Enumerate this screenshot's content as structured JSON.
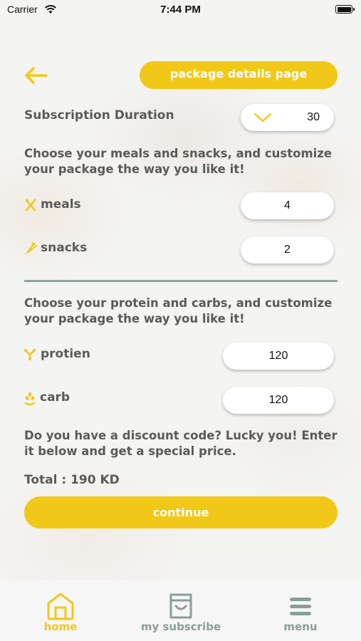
{
  "status_bar": {
    "carrier": "Carrier",
    "time": "7:44 PM"
  },
  "header": {
    "title": "package details page",
    "back_icon": "arrow-left-icon"
  },
  "subscription": {
    "label": "Subscription Duration",
    "value": "30",
    "dropdown_icon": "chevron-down-icon"
  },
  "meals_intro": "Choose your meals and snacks, and customize your package the way you like it!",
  "meals": {
    "label": "meals",
    "value": "4",
    "icon": "utensils-icon"
  },
  "snacks": {
    "label": "snacks",
    "value": "2",
    "icon": "carrot-icon"
  },
  "protein_intro": "Choose your protein and carbs, and customize your package the way you like it!",
  "protein": {
    "label": "protien",
    "value": "120",
    "icon": "protein-icon"
  },
  "carb": {
    "label": "carb",
    "value": "120",
    "icon": "wheat-icon"
  },
  "discount_text": "Do you have a discount code? Lucky you! Enter it below and get a special price.",
  "total": "Total : 190 KD",
  "continue_label": "continue",
  "tabs": [
    {
      "label": "home",
      "icon": "home-icon",
      "active": true
    },
    {
      "label": "my subscribe",
      "icon": "shopping-bag-icon",
      "active": false
    },
    {
      "label": "menu",
      "icon": "menu-icon",
      "active": false
    }
  ],
  "colors": {
    "accent": "#f2c818",
    "text": "#5a5a5a",
    "divider": "#8fa8a0",
    "inactive_tab": "#8a9e98"
  }
}
